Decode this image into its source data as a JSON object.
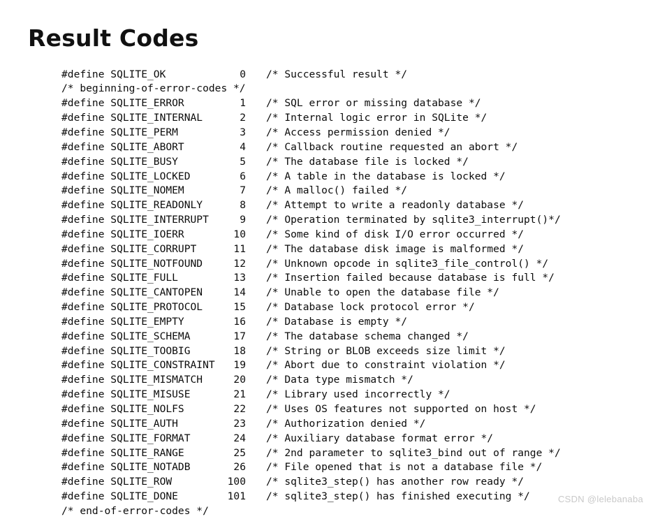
{
  "page": {
    "title": "Result Codes",
    "watermark": "CSDN @lelebanaba",
    "background_color": "#ffffff",
    "text_color": "#0c0c0c",
    "watermark_color": "#c9c9c9"
  },
  "code": {
    "language": "c",
    "directive": "#define",
    "lines": [
      {
        "kind": "define",
        "name": "SQLITE_OK",
        "value": "0",
        "comment": "/* Successful result */"
      },
      {
        "kind": "comment",
        "text": "/* beginning-of-error-codes */"
      },
      {
        "kind": "define",
        "name": "SQLITE_ERROR",
        "value": "1",
        "comment": "/* SQL error or missing database */"
      },
      {
        "kind": "define",
        "name": "SQLITE_INTERNAL",
        "value": "2",
        "comment": "/* Internal logic error in SQLite */"
      },
      {
        "kind": "define",
        "name": "SQLITE_PERM",
        "value": "3",
        "comment": "/* Access permission denied */"
      },
      {
        "kind": "define",
        "name": "SQLITE_ABORT",
        "value": "4",
        "comment": "/* Callback routine requested an abort */"
      },
      {
        "kind": "define",
        "name": "SQLITE_BUSY",
        "value": "5",
        "comment": "/* The database file is locked */"
      },
      {
        "kind": "define",
        "name": "SQLITE_LOCKED",
        "value": "6",
        "comment": "/* A table in the database is locked */"
      },
      {
        "kind": "define",
        "name": "SQLITE_NOMEM",
        "value": "7",
        "comment": "/* A malloc() failed */"
      },
      {
        "kind": "define",
        "name": "SQLITE_READONLY",
        "value": "8",
        "comment": "/* Attempt to write a readonly database */"
      },
      {
        "kind": "define",
        "name": "SQLITE_INTERRUPT",
        "value": "9",
        "comment": "/* Operation terminated by sqlite3_interrupt()*/"
      },
      {
        "kind": "define",
        "name": "SQLITE_IOERR",
        "value": "10",
        "comment": "/* Some kind of disk I/O error occurred */"
      },
      {
        "kind": "define",
        "name": "SQLITE_CORRUPT",
        "value": "11",
        "comment": "/* The database disk image is malformed */"
      },
      {
        "kind": "define",
        "name": "SQLITE_NOTFOUND",
        "value": "12",
        "comment": "/* Unknown opcode in sqlite3_file_control() */"
      },
      {
        "kind": "define",
        "name": "SQLITE_FULL",
        "value": "13",
        "comment": "/* Insertion failed because database is full */"
      },
      {
        "kind": "define",
        "name": "SQLITE_CANTOPEN",
        "value": "14",
        "comment": "/* Unable to open the database file */"
      },
      {
        "kind": "define",
        "name": "SQLITE_PROTOCOL",
        "value": "15",
        "comment": "/* Database lock protocol error */"
      },
      {
        "kind": "define",
        "name": "SQLITE_EMPTY",
        "value": "16",
        "comment": "/* Database is empty */"
      },
      {
        "kind": "define",
        "name": "SQLITE_SCHEMA",
        "value": "17",
        "comment": "/* The database schema changed */"
      },
      {
        "kind": "define",
        "name": "SQLITE_TOOBIG",
        "value": "18",
        "comment": "/* String or BLOB exceeds size limit */"
      },
      {
        "kind": "define",
        "name": "SQLITE_CONSTRAINT",
        "value": "19",
        "comment": "/* Abort due to constraint violation */"
      },
      {
        "kind": "define",
        "name": "SQLITE_MISMATCH",
        "value": "20",
        "comment": "/* Data type mismatch */"
      },
      {
        "kind": "define",
        "name": "SQLITE_MISUSE",
        "value": "21",
        "comment": "/* Library used incorrectly */"
      },
      {
        "kind": "define",
        "name": "SQLITE_NOLFS",
        "value": "22",
        "comment": "/* Uses OS features not supported on host */"
      },
      {
        "kind": "define",
        "name": "SQLITE_AUTH",
        "value": "23",
        "comment": "/* Authorization denied */"
      },
      {
        "kind": "define",
        "name": "SQLITE_FORMAT",
        "value": "24",
        "comment": "/* Auxiliary database format error */"
      },
      {
        "kind": "define",
        "name": "SQLITE_RANGE",
        "value": "25",
        "comment": "/* 2nd parameter to sqlite3_bind out of range */"
      },
      {
        "kind": "define",
        "name": "SQLITE_NOTADB",
        "value": "26",
        "comment": "/* File opened that is not a database file */"
      },
      {
        "kind": "define",
        "name": "SQLITE_ROW",
        "value": "100",
        "comment": "/* sqlite3_step() has another row ready */"
      },
      {
        "kind": "define",
        "name": "SQLITE_DONE",
        "value": "101",
        "comment": "/* sqlite3_step() has finished executing */"
      },
      {
        "kind": "comment",
        "text": "/* end-of-error-codes */"
      }
    ]
  }
}
